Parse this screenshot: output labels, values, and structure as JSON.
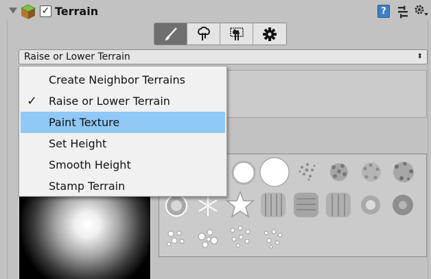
{
  "header": {
    "title": "Terrain",
    "enabled_check": "✓",
    "help_label": "?"
  },
  "toolbar": {
    "tools": [
      {
        "icon": "paintbrush-icon",
        "active": true
      },
      {
        "icon": "tree-icon",
        "active": false
      },
      {
        "icon": "detail-grass-icon",
        "active": false
      },
      {
        "icon": "gear-icon",
        "active": false
      }
    ]
  },
  "mode_select": {
    "value": "Raise or Lower Terrain",
    "arrow": "⬍"
  },
  "menu": {
    "items": [
      {
        "label": "Create Neighbor Terrains",
        "checked": false,
        "highlighted": false
      },
      {
        "label": "Raise or Lower Terrain",
        "checked": true,
        "highlighted": false
      },
      {
        "label": "Paint Texture",
        "checked": false,
        "highlighted": true
      },
      {
        "label": "Set Height",
        "checked": false,
        "highlighted": false
      },
      {
        "label": "Smooth Height",
        "checked": false,
        "highlighted": false
      },
      {
        "label": "Stamp Terrain",
        "checked": false,
        "highlighted": false
      }
    ],
    "check_glyph": "✓"
  },
  "colors": {
    "highlight": "#90c8f6",
    "panel": "#c2c2c2",
    "active_tool": "#6f6f6f"
  }
}
